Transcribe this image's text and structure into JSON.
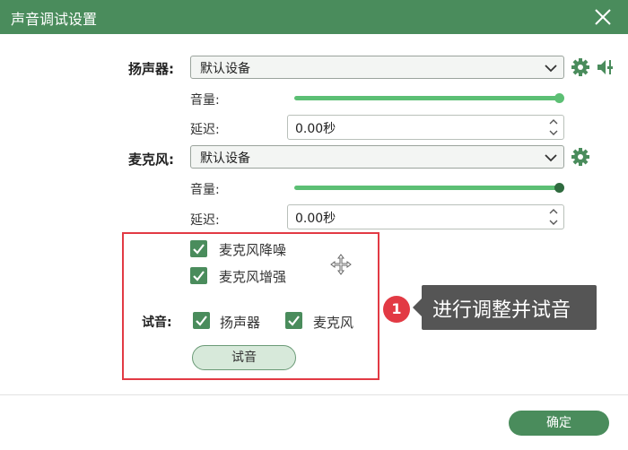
{
  "window": {
    "title": "声音调试设置"
  },
  "speaker": {
    "label": "扬声器:",
    "device": "默认设备",
    "volume_label": "音量:",
    "volume_level": 1.0,
    "delay_label": "延迟:",
    "delay_value": "0.00秒"
  },
  "mic": {
    "label": "麦克风:",
    "device": "默认设备",
    "volume_label": "音量:",
    "volume_level": 1.0,
    "delay_label": "延迟:",
    "delay_value": "0.00秒"
  },
  "options": {
    "noise_reduction": {
      "label": "麦克风降噪",
      "checked": true
    },
    "enhance": {
      "label": "麦克风增强",
      "checked": true
    }
  },
  "test": {
    "label": "试音:",
    "speaker": {
      "label": "扬声器",
      "checked": true
    },
    "mic": {
      "label": "麦克风",
      "checked": true
    },
    "button": "试音"
  },
  "annotation": {
    "badge": "1",
    "text": "进行调整并试音"
  },
  "footer": {
    "ok": "确定"
  },
  "colors": {
    "accent": "#4a8c5c",
    "slider": "#5cbf74",
    "highlight": "#e23a44",
    "callout": "#555555"
  }
}
